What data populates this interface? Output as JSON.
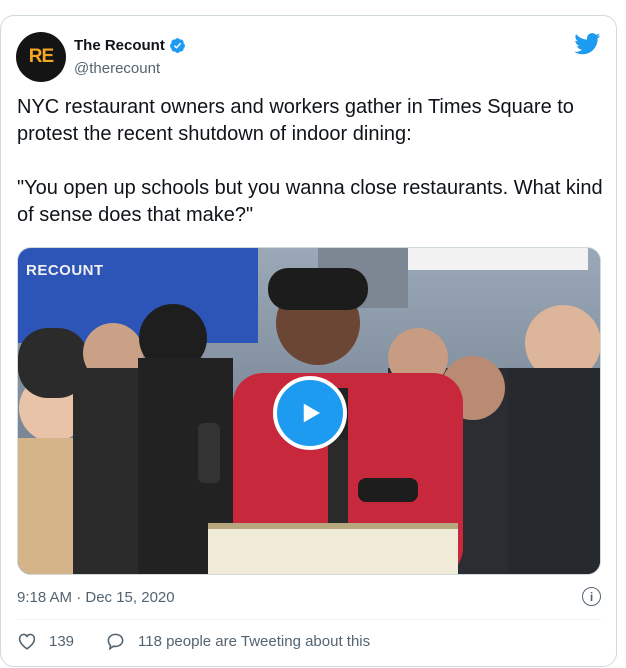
{
  "tweet": {
    "avatar_text": "RE",
    "author_name": "The Recount",
    "author_handle": "@therecount",
    "text": "NYC restaurant owners and workers gather in Times Square to protest the recent shutdown of indoor dining:\n\n\"You open up schools but you wanna close restaurants. What kind of sense does that make?\"",
    "timestamp": "9:18 AM · Dec 15, 2020",
    "like_count": "139",
    "conversation_text": "118 people are Tweeting about this"
  },
  "media": {
    "watermark": "RECOUNT",
    "type": "video"
  },
  "icons": {
    "verified": "verified-badge-icon",
    "brand": "twitter-bird-icon",
    "play": "play-icon",
    "info": "info-icon",
    "like": "heart-icon",
    "reply": "speech-bubble-icon"
  },
  "colors": {
    "accent": "#1d9bf0",
    "secondary_text": "#536471",
    "primary_text": "#0f1419",
    "jacket_red": "#c8283c"
  }
}
